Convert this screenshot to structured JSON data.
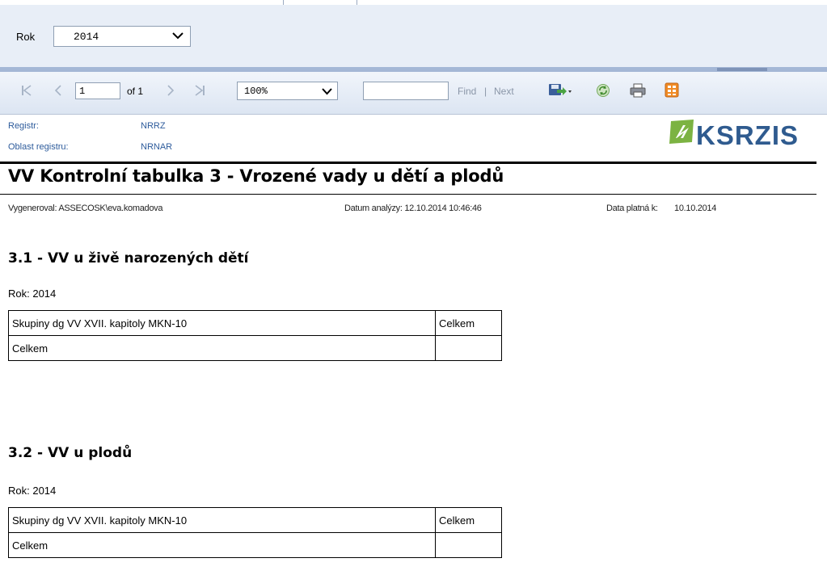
{
  "params": {
    "year_label": "Rok",
    "year_value": "2014"
  },
  "toolbar": {
    "page_current": "1",
    "page_of": "of 1",
    "zoom": "100%",
    "find_text": "",
    "find_label": "Find",
    "separator": "|",
    "next_label": "Next"
  },
  "report": {
    "registr_label": "Registr:",
    "registr_value": "NRRZ",
    "oblast_label": "Oblast registru:",
    "oblast_value": "NRNAR",
    "logo_text": "KSRZIS",
    "title": "VV Kontrolní tabulka 3 - Vrozené vady u dětí a plodů",
    "generated_by": "Vygeneroval: ASSECOSK\\eva.komadova",
    "analysis_date": "Datum analýzy: 12.10.2014 10:46:46",
    "valid_label": "Data platná k:",
    "valid_value": "10.10.2014",
    "sections": [
      {
        "title": "3.1 - VV u živě narozených dětí",
        "rok": "Rok: 2014",
        "header": [
          "Skupiny dg VV XVII. kapitoly MKN-10",
          "Celkem"
        ],
        "rows": [
          [
            "Celkem",
            ""
          ]
        ]
      },
      {
        "title": "3.2 - VV u plodů",
        "rok": "Rok: 2014",
        "header": [
          "Skupiny dg VV XVII. kapitoly MKN-10",
          "Celkem"
        ],
        "rows": [
          [
            "Celkem",
            ""
          ]
        ]
      }
    ]
  }
}
